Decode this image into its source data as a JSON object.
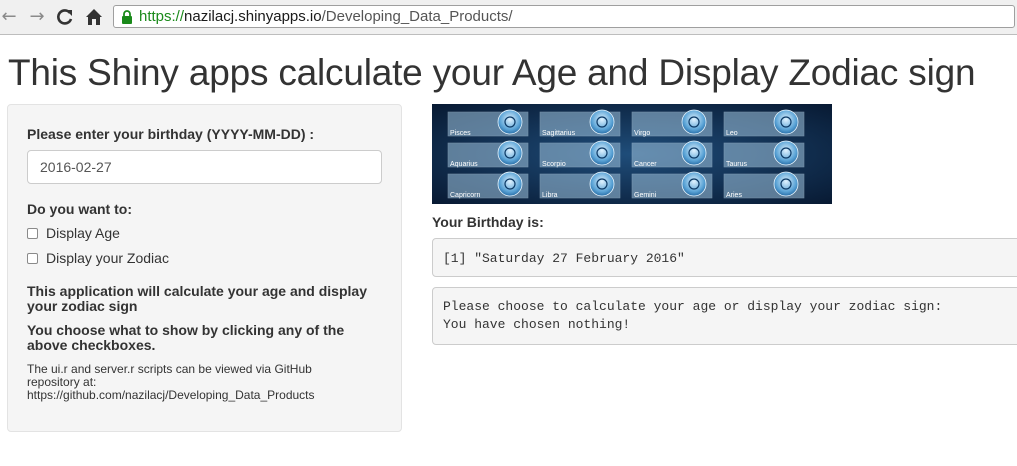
{
  "browser": {
    "url_scheme": "https://",
    "url_host": "nazilacj.shinyapps.io",
    "url_path": "/Developing_Data_Products/",
    "back_icon": "arrow-left-icon",
    "forward_icon": "arrow-right-icon",
    "reload_icon": "reload-icon",
    "home_icon": "home-icon"
  },
  "page": {
    "title": "This Shiny apps calculate your Age and Display Zodiac sign"
  },
  "sidebar": {
    "birthday_label": "Please enter your birthday (YYYY-MM-DD) :",
    "birthday_value": "2016-02-27",
    "options_label": "Do you want to:",
    "checkbox_age_label": "Display Age",
    "checkbox_age_checked": false,
    "checkbox_zodiac_label": "Display your Zodiac",
    "checkbox_zodiac_checked": false,
    "desc_1": "This application will calculate your age and display your zodiac sign",
    "desc_2": "You choose what to show by clicking any of the above checkboxes.",
    "note": "The ui.r and server.r scripts can be viewed via GitHub repository at: https://github.com/nazilacj/Developing_Data_Products"
  },
  "zodiac_banner": {
    "signs": [
      "Pisces",
      "Sagittarius",
      "Virgo",
      "Leo",
      "Aquarius",
      "Scorpio",
      "Cancer",
      "Taurus",
      "Capricorn",
      "Libra",
      "Gemini",
      "Aries"
    ]
  },
  "main": {
    "birthday_heading": "Your Birthday is:",
    "birthday_output": "[1] \"Saturday 27 February 2016\"",
    "choice_output": "Please choose to calculate your age or display your zodiac sign:\nYou have chosen nothing!"
  },
  "colors": {
    "accent_url_green": "#1a8a1a",
    "panel_bg": "#f5f5f5",
    "banner_bg": "#0b2545"
  }
}
